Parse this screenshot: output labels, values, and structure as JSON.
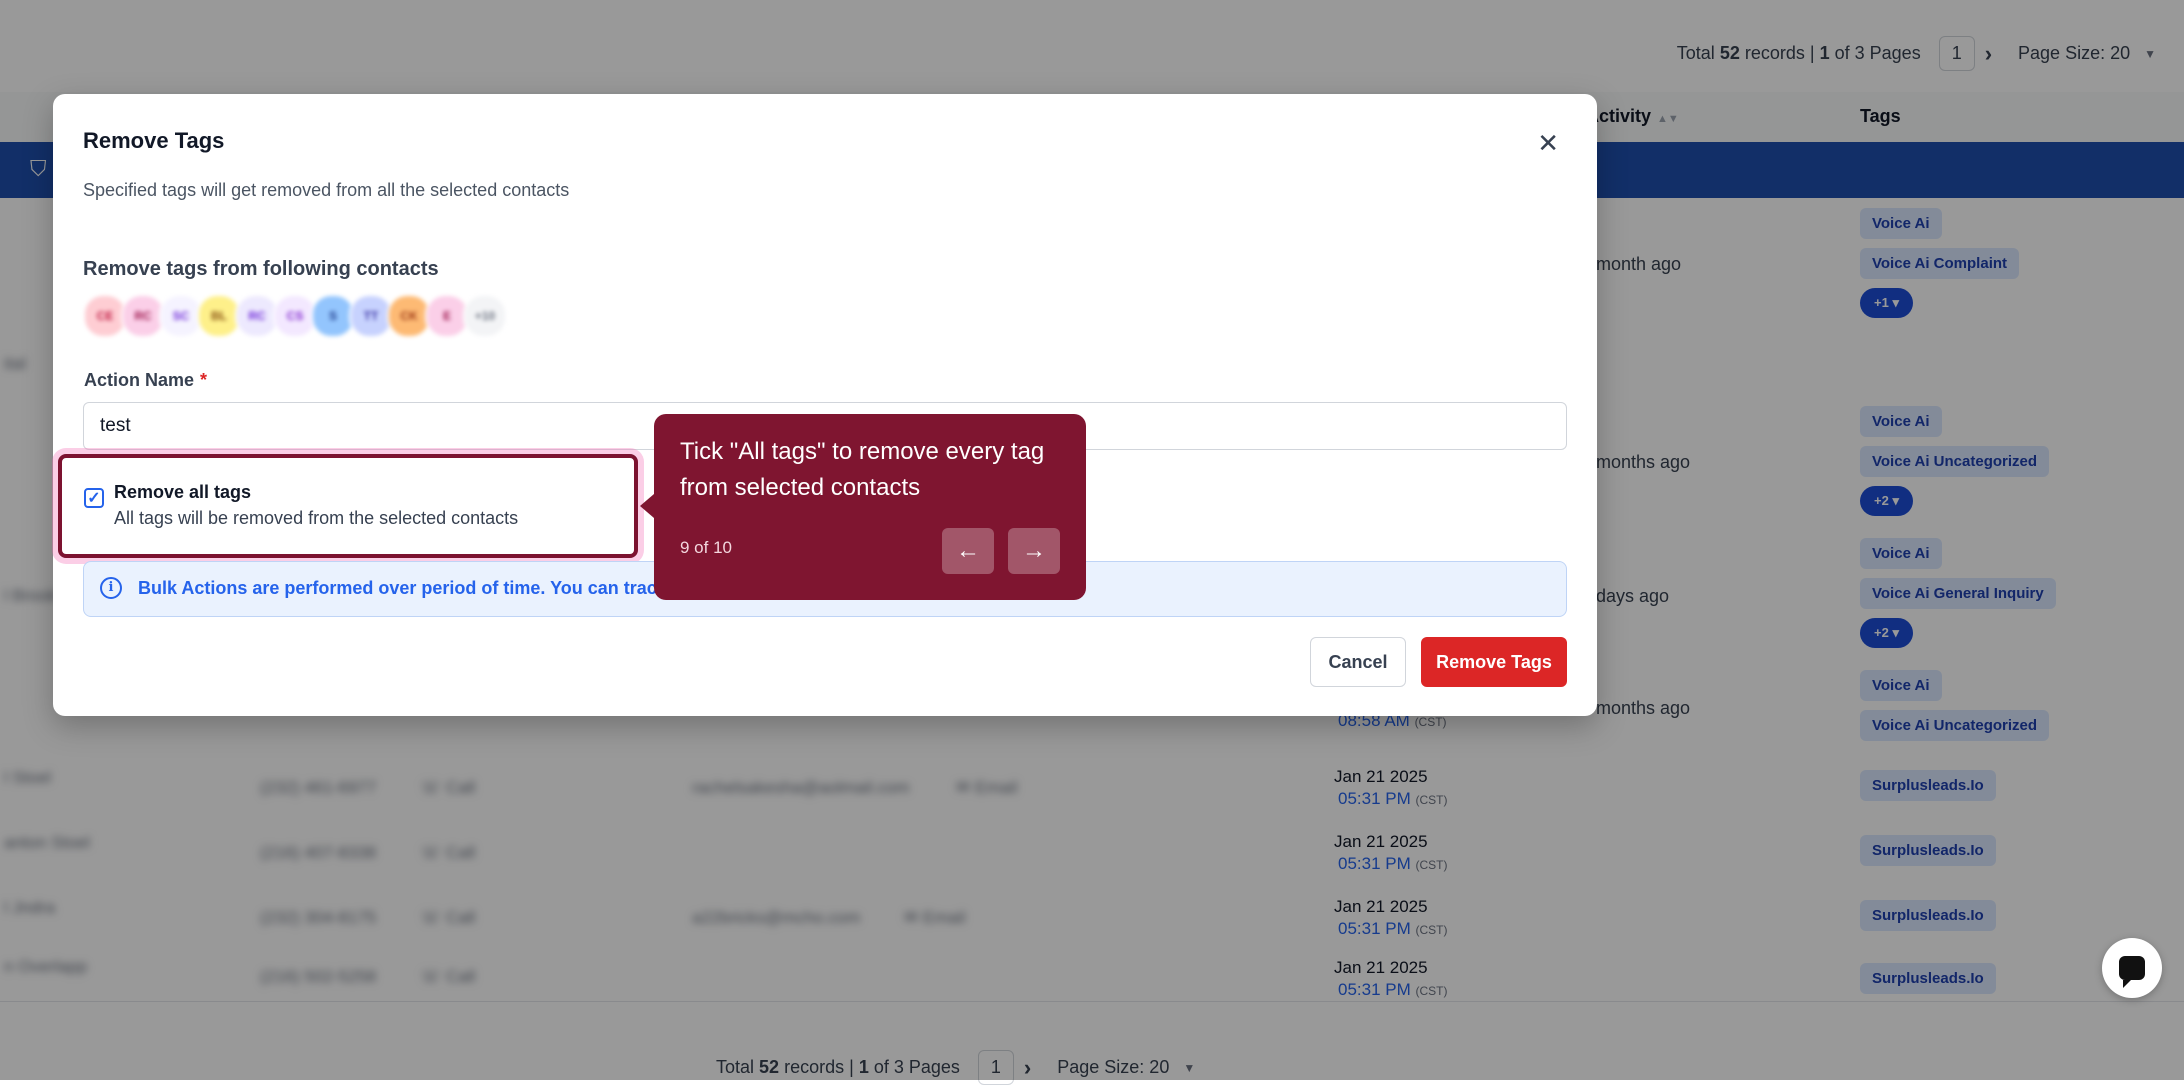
{
  "pager_top": {
    "prefix": "Total",
    "count": "52",
    "records": "records |",
    "page": "1",
    "of_pages": "of 3 Pages",
    "current": "1",
    "size_label": "Page Size: 20"
  },
  "pager_bottom": {
    "prefix": "Total",
    "count": "52",
    "records": "records |",
    "page": "1",
    "of_pages": "of 3 Pages",
    "current": "1",
    "size_label": "Page Size: 20"
  },
  "table": {
    "headers": {
      "activity": "Activity",
      "tags": "Tags"
    },
    "rows": [
      {
        "ago": "month ago",
        "tags": [
          "Voice Ai",
          "Voice Ai Complaint"
        ],
        "more": "+1"
      },
      {
        "ago": "",
        "tags": [],
        "more": ""
      },
      {
        "ago": "months ago",
        "tags": [
          "Voice Ai",
          "Voice Ai Uncategorized"
        ],
        "more": "+2"
      },
      {
        "ago": "days ago",
        "tags": [
          "Voice Ai",
          "Voice Ai General Inquiry"
        ],
        "more": "+2"
      },
      {
        "ago": "months ago",
        "time": "08:58 AM",
        "tz": "(CST)",
        "tags": [
          "Voice Ai",
          "Voice Ai Uncategorized"
        ],
        "more": ""
      },
      {
        "date": "Jan 21 2025",
        "time": "05:31 PM",
        "tz": "(CST)",
        "tags": [
          "Surplusleads.Io"
        ]
      },
      {
        "date": "Jan 21 2025",
        "time": "05:31 PM",
        "tz": "(CST)",
        "tags": [
          "Surplusleads.Io"
        ]
      },
      {
        "date": "Jan 21 2025",
        "time": "05:31 PM",
        "tz": "(CST)",
        "tags": [
          "Surplusleads.Io"
        ]
      },
      {
        "date": "Jan 21 2025",
        "time": "05:31 PM",
        "tz": "(CST)",
        "tags": [
          "Surplusleads.Io"
        ]
      }
    ]
  },
  "modal": {
    "title": "Remove Tags",
    "close_icon": "close-icon",
    "subtitle": "Specified tags will get removed from all the selected contacts",
    "contacts_label": "Remove tags from following contacts",
    "action_name_label": "Action Name",
    "required_mark": "*",
    "action_name_value": "test",
    "checkbox_checked": true,
    "checkbox_title": "Remove all tags",
    "checkbox_desc": "All tags will be removed from the selected contacts",
    "info_text": "Bulk Actions are performed over period of time. You can track t",
    "cancel_label": "Cancel",
    "remove_label": "Remove Tags"
  },
  "tooltip": {
    "text": "Tick \"All tags\" to remove every tag from selected contacts",
    "step": "9 of 10",
    "prev_icon": "arrow-left-icon",
    "next_icon": "arrow-right-icon"
  },
  "colors": {
    "primary": "#2563eb",
    "danger": "#dc2626",
    "tour": "#7f1530",
    "filter_bar": "#1e4fae"
  }
}
